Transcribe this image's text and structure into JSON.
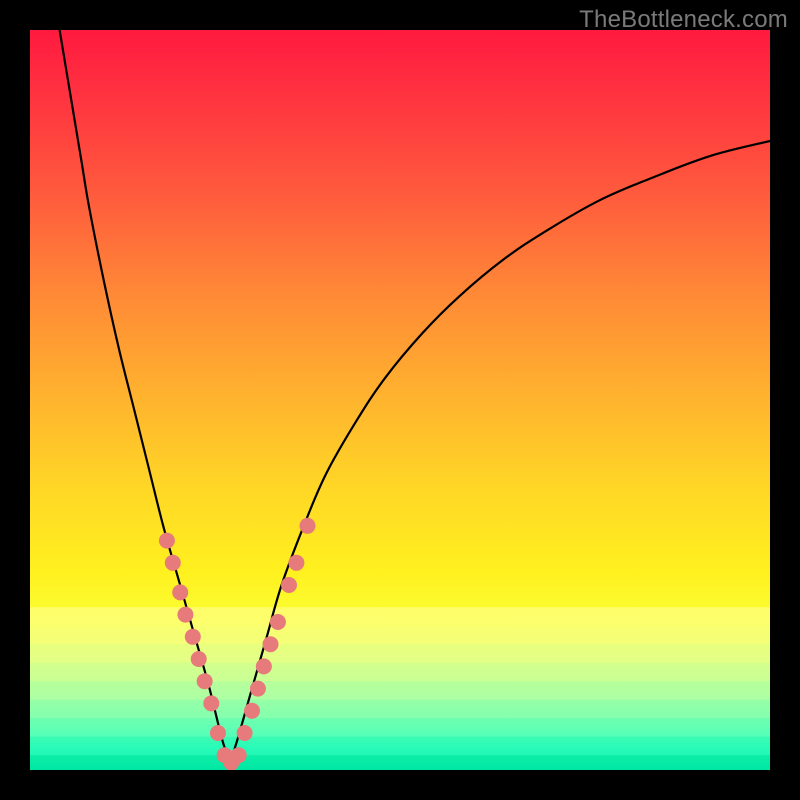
{
  "watermark": "TheBottleneck.com",
  "chart_data": {
    "type": "line",
    "title": "",
    "xlabel": "",
    "ylabel": "",
    "xlim": [
      0,
      100
    ],
    "ylim": [
      0,
      100
    ],
    "series": [
      {
        "name": "left-branch",
        "x": [
          4.0,
          5.0,
          6.0,
          7.0,
          8.0,
          10.0,
          12.0,
          14.0,
          16.0,
          18.0,
          20.0,
          22.0,
          24.0,
          25.0,
          26.0,
          27.0
        ],
        "values": [
          100,
          94,
          88,
          82,
          76,
          66,
          57,
          49,
          41,
          33,
          26,
          19,
          12,
          8,
          4,
          1
        ]
      },
      {
        "name": "right-branch",
        "x": [
          27.0,
          28.0,
          30.0,
          32.0,
          34.0,
          37.0,
          40.0,
          44.0,
          48.0,
          53.0,
          58.0,
          64.0,
          70.0,
          77.0,
          84.0,
          92.0,
          100.0
        ],
        "values": [
          1,
          4,
          11,
          18,
          25,
          33,
          40,
          47,
          53,
          59,
          64,
          69,
          73,
          77,
          80,
          83,
          85
        ]
      }
    ],
    "markers": {
      "name": "data-points",
      "x": [
        18.5,
        19.3,
        20.3,
        21.0,
        22.0,
        22.8,
        23.6,
        24.5,
        25.4,
        26.3,
        27.2,
        28.2,
        29.0,
        30.0,
        30.8,
        31.6,
        32.5,
        33.5,
        35.0,
        36.0,
        37.5
      ],
      "values": [
        31,
        28,
        24,
        21,
        18,
        15,
        12,
        9,
        5,
        2,
        1,
        2,
        5,
        8,
        11,
        14,
        17,
        20,
        25,
        28,
        33
      ],
      "color": "#e77a7a"
    },
    "gradient_bands": [
      {
        "y": 78,
        "h": 2.5,
        "color": "#ffff9a"
      },
      {
        "y": 80.5,
        "h": 2.5,
        "color": "#f7ffa1"
      },
      {
        "y": 83,
        "h": 2.5,
        "color": "#e4ffab"
      },
      {
        "y": 85.5,
        "h": 2.5,
        "color": "#c9ffb7"
      },
      {
        "y": 88,
        "h": 2.5,
        "color": "#a6ffc2"
      },
      {
        "y": 90.5,
        "h": 2.5,
        "color": "#7effc9"
      },
      {
        "y": 93,
        "h": 2.5,
        "color": "#52ffcb"
      },
      {
        "y": 95.5,
        "h": 2.5,
        "color": "#28f7c0"
      },
      {
        "y": 98,
        "h": 2.0,
        "color": "#00e7a4"
      }
    ]
  }
}
